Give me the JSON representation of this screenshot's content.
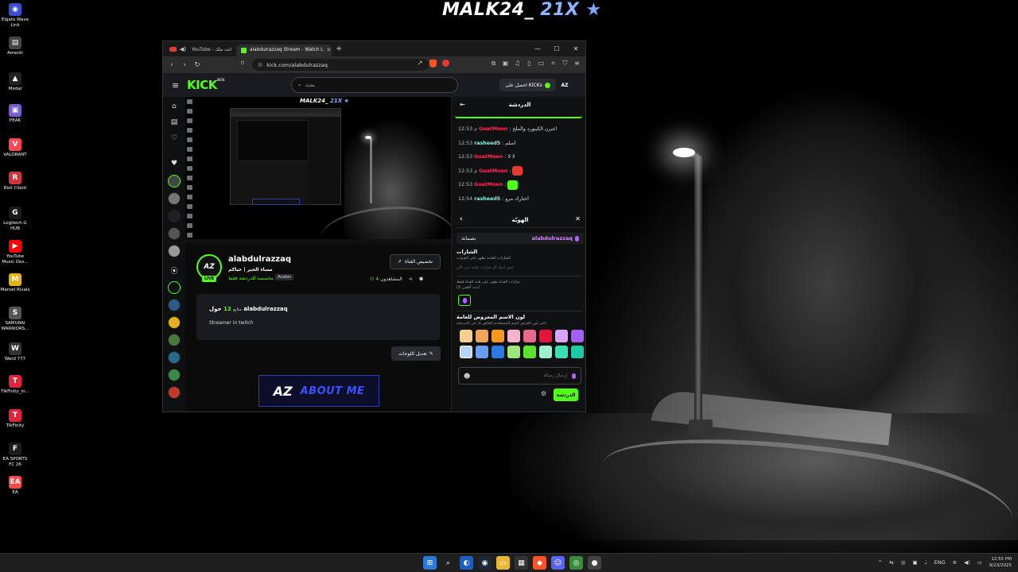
{
  "desktop": {
    "wallpaper_title_main": "MALK24_",
    "wallpaper_title_accent": "21X",
    "icons": [
      {
        "label": "Elgato Wave Link",
        "color": "#3a4ccf",
        "glyph": "◉"
      },
      {
        "label": "Amenti",
        "color": "#444444",
        "glyph": "▤"
      },
      {
        "label": "Medal",
        "color": "#222222",
        "glyph": "▲"
      },
      {
        "label": "PEAK",
        "color": "#7a5bd0",
        "glyph": "▣"
      },
      {
        "label": "VALORANT",
        "color": "#ff4655",
        "glyph": "V"
      },
      {
        "label": "Riot Client",
        "color": "#d13639",
        "glyph": "R"
      },
      {
        "label": "Logitech G HUB",
        "color": "#1a1a1a",
        "glyph": "G"
      },
      {
        "label": "YouTube Music Des...",
        "color": "#ff0000",
        "glyph": "▶"
      },
      {
        "label": "Marvel Rivals",
        "color": "#e3b11a",
        "glyph": "M"
      },
      {
        "label": "SAMURAI WARRIORS...",
        "color": "#555555",
        "glyph": "S"
      },
      {
        "label": "Ward 777",
        "color": "#333333",
        "glyph": "W"
      },
      {
        "label": "TikFinity_in...",
        "color": "#e0243c",
        "glyph": "T"
      },
      {
        "label": "TikFinity",
        "color": "#e0243c",
        "glyph": "T"
      },
      {
        "label": "EA SPORTS FC 26",
        "color": "#1d1d1d",
        "glyph": "F"
      },
      {
        "label": "EA",
        "color": "#ff4747",
        "glyph": "EA"
      }
    ]
  },
  "browser": {
    "tab_inactive_label": "YouTube - انت ملك",
    "tab_active_label": "alabdulrazzaq Stream - Watch L",
    "url": "kick.com/alabdulrazzaq"
  },
  "kick": {
    "logo": "KICK",
    "logo_sup": "BETA",
    "search_placeholder": "بحث",
    "get_kicks_label": "احصل على KICKs",
    "header_avatar": "AZ",
    "stream_title_main": "MALK24_",
    "stream_title_accent": "21X",
    "channel": {
      "avatar": "AZ",
      "live": "LIVE",
      "name": "alabdulrazzaq",
      "subtitle": "مساء الخير | حياكم",
      "category": "مخصصة للدردشة فقط",
      "language": "Arabic",
      "customize_label": "تخصيص القناة",
      "viewers_label": "المشاهدون",
      "viewers_count": "4",
      "followers_count": "12",
      "followers_label": "متابع",
      "about_title": "حول alabdulrazzaq",
      "about_description": "Streamer in twitch",
      "edit_panels_label": "تعديل اللوحات",
      "banner_logo": "AZ",
      "banner_text": "ABOUT ME"
    }
  },
  "chat": {
    "header": "الدردشة",
    "messages": [
      {
        "time": "12:53 م",
        "user": "GoatMoon",
        "color": "red",
        "text": "اعبرن الكيبورد والملح"
      },
      {
        "time": "12:53",
        "user": "rasheed5",
        "color": "teal",
        "text": "اسلم"
      },
      {
        "time": "12:53",
        "user": "GoatMoon",
        "color": "red",
        "text": "لا لا"
      },
      {
        "time": "12:53 م",
        "user": "GoatMoon",
        "color": "red",
        "text": "",
        "emote": "red"
      },
      {
        "time": "12:53",
        "user": "GoatMoon",
        "color": "red",
        "text": "",
        "emote": "green"
      },
      {
        "time": "12:54",
        "user": "rasheed5",
        "color": "teal",
        "text": "اختارك مرو"
      }
    ],
    "badges_panel": {
      "title": "الهويّة",
      "username": "alabdulrazzaq",
      "user_suffix": "بصماتة",
      "badges_title": "الشارات",
      "badges_desc": "الشارات العامة تظهر على القنوات",
      "badges_empty": "ليس لديك أي شارات عامة حتى الآن",
      "channel_badges_desc": "شارات القناة تظهر على هذه القناة فقط",
      "channel_badges_count": "(عدد أقصى 3)",
      "color_title": "لون الاسم المعروض للعامة",
      "color_desc": "اختر لون العرض لاسم المستخدم الخاص بك في الدردشة",
      "swatches": [
        "#f5cf8f",
        "#f2a45a",
        "#f59a1e",
        "#f6b3cb",
        "#e86a8a",
        "#e1143c",
        "#d9a4f5",
        "#a45ef2",
        "#b7d4f5",
        "#6a9cf0",
        "#2a7ae2",
        "#9ce67a",
        "#5ce22e",
        "#9ef0d2",
        "#3ae0b4",
        "#1ec9a6"
      ],
      "selected_swatch": 8
    },
    "input_placeholder": "إرسال رسالة",
    "send_label": "الدردشة"
  },
  "taskbar": {
    "apps": [
      {
        "name": "start",
        "color": "#2d7ad6",
        "glyph": "⊞"
      },
      {
        "name": "search",
        "color": "transparent",
        "glyph": "⌕"
      },
      {
        "name": "edge-copilot",
        "color": "#1e5fbf",
        "glyph": "◐"
      },
      {
        "name": "steam",
        "color": "#1b2838",
        "glyph": "◉"
      },
      {
        "name": "file-explorer",
        "color": "#e8b83a",
        "glyph": "▭"
      },
      {
        "name": "store",
        "color": "#333333",
        "glyph": "▦"
      },
      {
        "name": "brave",
        "color": "#fb542b",
        "glyph": "◆"
      },
      {
        "name": "discord",
        "color": "#5865f2",
        "glyph": "☺"
      },
      {
        "name": "chrome",
        "color": "#3c8a3e",
        "glyph": "◎"
      },
      {
        "name": "obs",
        "color": "#444444",
        "glyph": "●"
      }
    ],
    "lang": "ENG",
    "time": "12:55 PM",
    "date": "9/23/2025"
  }
}
